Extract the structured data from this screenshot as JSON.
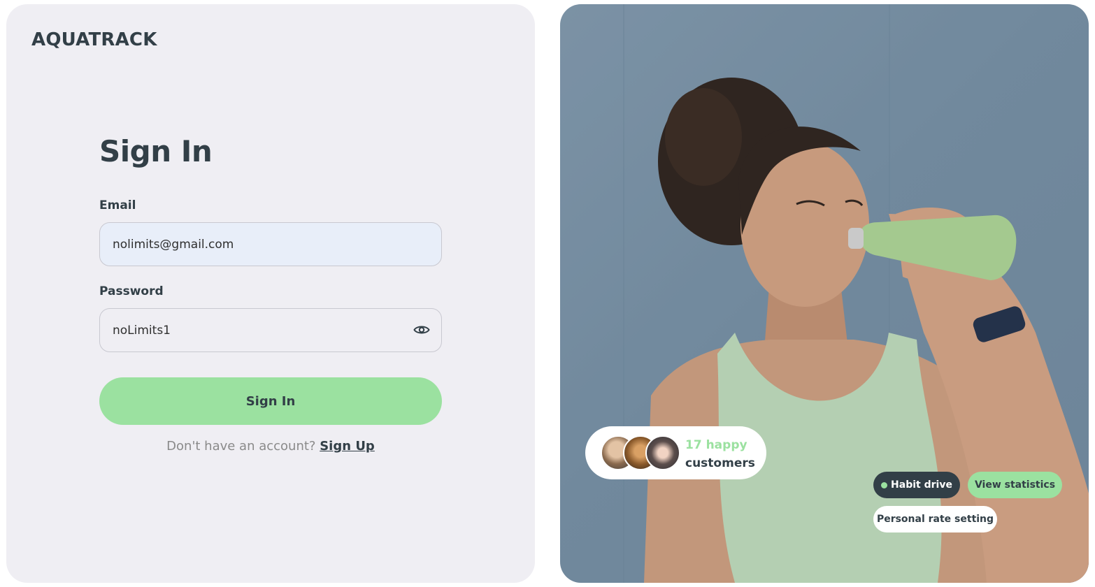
{
  "brand": {
    "logo_text": "AQUATRACK"
  },
  "form": {
    "title": "Sign In",
    "email_label": "Email",
    "email_value": "nolimits@gmail.com",
    "password_label": "Password",
    "password_value": "noLimits1",
    "submit_label": "Sign In",
    "signup_prompt": "Don't have an account?",
    "signup_link": "Sign Up"
  },
  "hero": {
    "customers_count": "17 happy",
    "customers_label": "customers",
    "tags": {
      "habit": "Habit drive",
      "stats": "View statistics",
      "personal": "Personal rate setting"
    }
  },
  "icons": {
    "password_toggle": "eye-icon"
  },
  "colors": {
    "accent": "#9be1a0",
    "dark": "#323f47",
    "panel_bg": "#efeef3",
    "email_bg": "#e8eef9"
  }
}
